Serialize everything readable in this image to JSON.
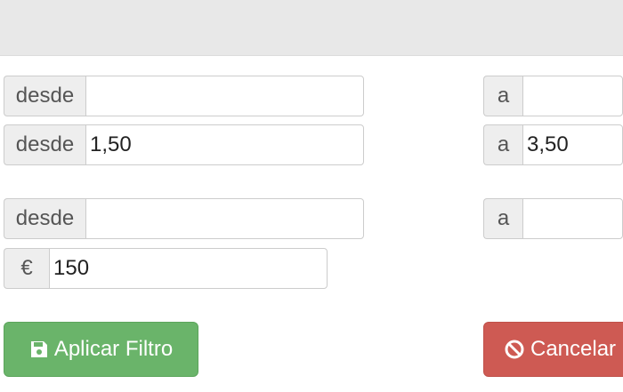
{
  "form": {
    "rows": [
      {
        "from_label": "desde",
        "from_value": "",
        "to_label": "a",
        "to_value": ""
      },
      {
        "from_label": "desde",
        "from_value": "1,50",
        "to_label": "a",
        "to_value": "3,50"
      },
      {
        "from_label": "desde",
        "from_value": "",
        "to_label": "a",
        "to_value": ""
      }
    ],
    "price": {
      "currency_symbol": "€",
      "value": "150"
    }
  },
  "buttons": {
    "apply_label": "Aplicar Filtro",
    "apply_icon": "save-icon",
    "apply_color": "#6ab46a",
    "cancel_label": "Cancelar",
    "cancel_icon": "ban-icon",
    "cancel_color": "#ce5a53"
  }
}
